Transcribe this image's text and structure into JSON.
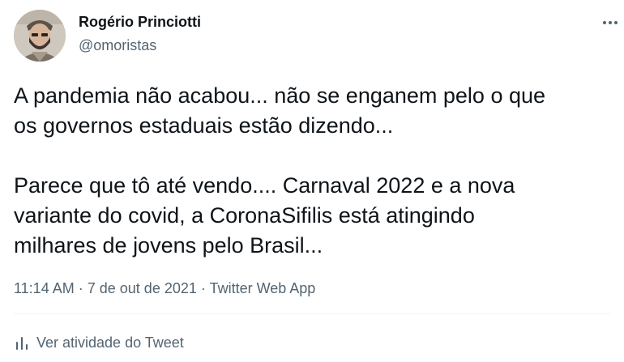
{
  "tweet": {
    "author_name": "Rogério Princiotti",
    "author_handle": "@omoristas",
    "text_lines": [
      "A pandemia não acabou... não se enganem pelo o que",
      "os governos estaduais estão dizendo...",
      "",
      "Parece que tô até vendo.... Carnaval 2022 e a nova",
      "variante do covid, a CoronaSifilis está atingindo",
      "milhares de jovens pelo Brasil..."
    ],
    "time": "11:14 AM",
    "date": "7 de out de 2021",
    "source": "Twitter Web App",
    "separator": "·",
    "activity_label": "Ver atividade do Tweet",
    "icons": {
      "more": "more-horizontal-icon",
      "activity": "bar-chart-icon"
    }
  },
  "colors": {
    "text_primary": "#0f1419",
    "text_secondary": "#536471",
    "divider": "#eff3f4"
  }
}
